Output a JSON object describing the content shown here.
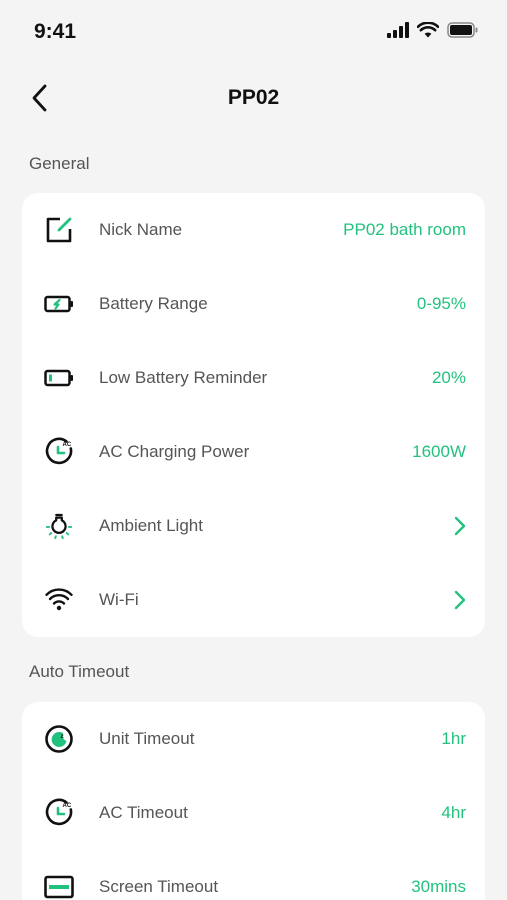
{
  "status_bar": {
    "time": "9:41"
  },
  "nav": {
    "title": "PP02"
  },
  "sections": {
    "general": {
      "label": "General",
      "rows": [
        {
          "label": "Nick Name",
          "value": "PP02 bath room"
        },
        {
          "label": "Battery Range",
          "value": "0-95%"
        },
        {
          "label": "Low Battery Reminder",
          "value": "20%"
        },
        {
          "label": "AC Charging Power",
          "value": "1600W"
        },
        {
          "label": "Ambient Light"
        },
        {
          "label": "Wi-Fi"
        }
      ]
    },
    "auto_timeout": {
      "label": "Auto Timeout",
      "rows": [
        {
          "label": "Unit Timeout",
          "value": "1hr"
        },
        {
          "label": "AC Timeout",
          "value": "4hr"
        },
        {
          "label": "Screen Timeout",
          "value": "30mins"
        }
      ]
    }
  },
  "icons": {
    "nick_name": "edit-icon",
    "battery_range": "battery-charging-icon",
    "low_battery": "battery-low-icon",
    "ac_charging": "ac-timer-icon",
    "ambient_light": "light-bulb-icon",
    "wifi": "wifi-icon",
    "unit_timeout": "sleep-timer-icon",
    "ac_timeout": "ac-timer-icon",
    "screen_timeout": "screen-icon"
  },
  "colors": {
    "accent": "#22c27e",
    "background": "#f4f4f4",
    "card": "#ffffff"
  }
}
